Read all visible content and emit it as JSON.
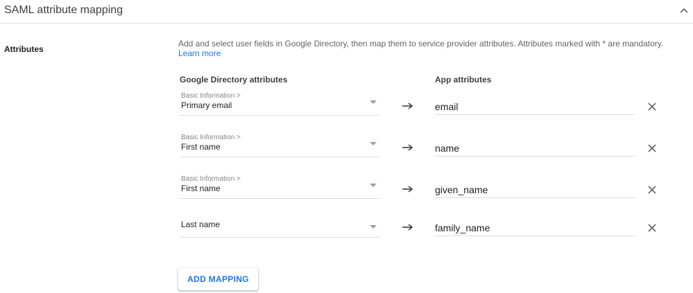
{
  "header": {
    "title": "SAML attribute mapping",
    "collapse_icon": "chevron-up-icon"
  },
  "section": {
    "label": "Attributes",
    "description": "Add and select user fields in Google Directory, then map them to service provider attributes. Attributes marked with * are mandatory.",
    "learn_more": "Learn more"
  },
  "columns": {
    "google": "Google Directory attributes",
    "app": "App attributes"
  },
  "mappings": [
    {
      "category": "Basic Information >",
      "field": "Primary email",
      "app_value": "email"
    },
    {
      "category": "Basic Information >",
      "field": "First name",
      "app_value": "name"
    },
    {
      "category": "Basic Information >",
      "field": "First name",
      "app_value": "given_name"
    },
    {
      "category": "",
      "field": "Last name",
      "app_value": "family_name"
    }
  ],
  "add_button": "ADD MAPPING",
  "colors": {
    "accent": "#1a73e8",
    "text": "#202124",
    "muted": "#5f6368",
    "divider": "#dadce0"
  }
}
